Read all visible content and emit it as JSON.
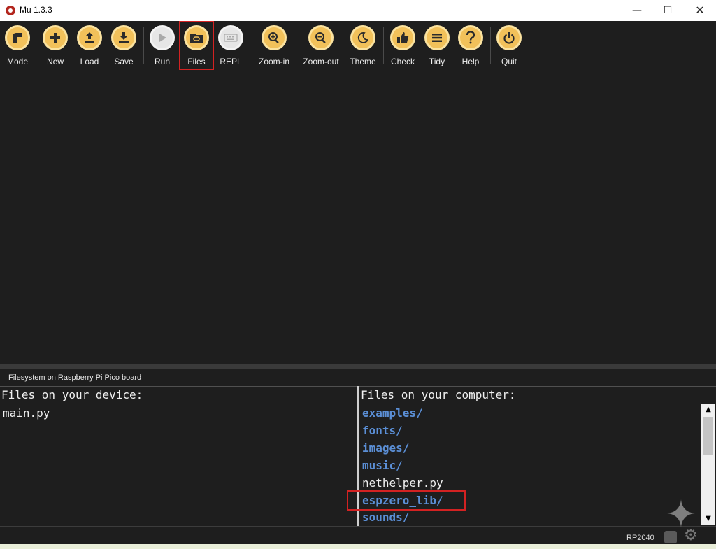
{
  "window": {
    "title": "Mu 1.3.3",
    "controls": {
      "minimize": "—",
      "maximize": "☐",
      "close": "✕"
    }
  },
  "toolbar": {
    "buttons": [
      {
        "label": "Mode",
        "icon": "mode-icon"
      },
      {
        "label": "New",
        "icon": "plus-icon"
      },
      {
        "label": "Load",
        "icon": "upload-icon"
      },
      {
        "label": "Save",
        "icon": "download-icon"
      },
      {
        "label": "Run",
        "icon": "play-icon"
      },
      {
        "label": "Files",
        "icon": "files-icon",
        "highlighted": true
      },
      {
        "label": "REPL",
        "icon": "keyboard-icon"
      },
      {
        "label": "Zoom-in",
        "icon": "zoom-in-icon"
      },
      {
        "label": "Zoom-out",
        "icon": "zoom-out-icon"
      },
      {
        "label": "Theme",
        "icon": "moon-icon"
      },
      {
        "label": "Check",
        "icon": "thumbs-up-icon"
      },
      {
        "label": "Tidy",
        "icon": "lines-icon"
      },
      {
        "label": "Help",
        "icon": "question-icon"
      },
      {
        "label": "Quit",
        "icon": "power-icon"
      }
    ]
  },
  "filesystem": {
    "title": "Filesystem on Raspberry Pi Pico board",
    "device": {
      "header": "Files on your device:",
      "files": [
        "main.py"
      ]
    },
    "computer": {
      "header": "Files on your computer:",
      "items": [
        {
          "name": "examples/",
          "type": "dir"
        },
        {
          "name": "fonts/",
          "type": "dir"
        },
        {
          "name": "images/",
          "type": "dir"
        },
        {
          "name": "music/",
          "type": "dir"
        },
        {
          "name": "nethelper.py",
          "type": "file"
        },
        {
          "name": "espzero_lib/",
          "type": "dir",
          "highlighted": true
        },
        {
          "name": "sounds/",
          "type": "dir"
        }
      ]
    }
  },
  "statusbar": {
    "board": "RP2040"
  },
  "colors": {
    "accent": "#f2c15a",
    "highlight": "#d32222",
    "directory": "#5b8fd6",
    "background": "#1e1e1e"
  }
}
